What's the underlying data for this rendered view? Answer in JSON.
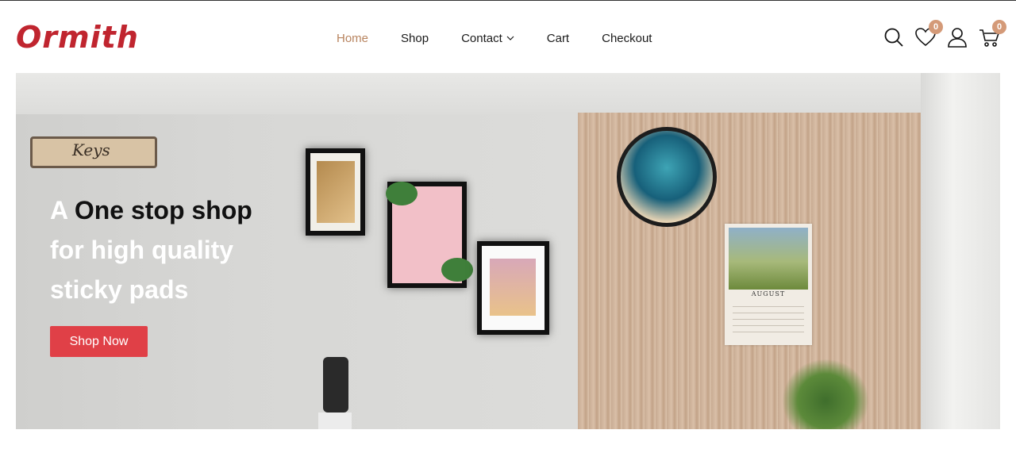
{
  "brand": {
    "name": "Ormith",
    "color": "#c0252f"
  },
  "nav": {
    "items": [
      {
        "label": "Home",
        "active": true
      },
      {
        "label": "Shop",
        "active": false
      },
      {
        "label": "Contact",
        "active": false,
        "has_dropdown": true
      },
      {
        "label": "Cart",
        "active": false
      },
      {
        "label": "Checkout",
        "active": false
      }
    ],
    "active_color": "#b8845f"
  },
  "header_icons": {
    "search": "search-icon",
    "wishlist": {
      "icon": "heart-icon",
      "count": "0"
    },
    "account": "user-icon",
    "cart": {
      "icon": "cart-icon",
      "count": "0"
    },
    "badge_color": "#d49a78"
  },
  "hero": {
    "title_part1": "A",
    "title_part2": "One stop shop",
    "title_line2": "for high quality",
    "title_line3": "sticky pads",
    "cta_label": "Shop Now",
    "cta_color": "#e04047",
    "keyrack_text": "Keys",
    "calendar_month": "AUGUST"
  }
}
